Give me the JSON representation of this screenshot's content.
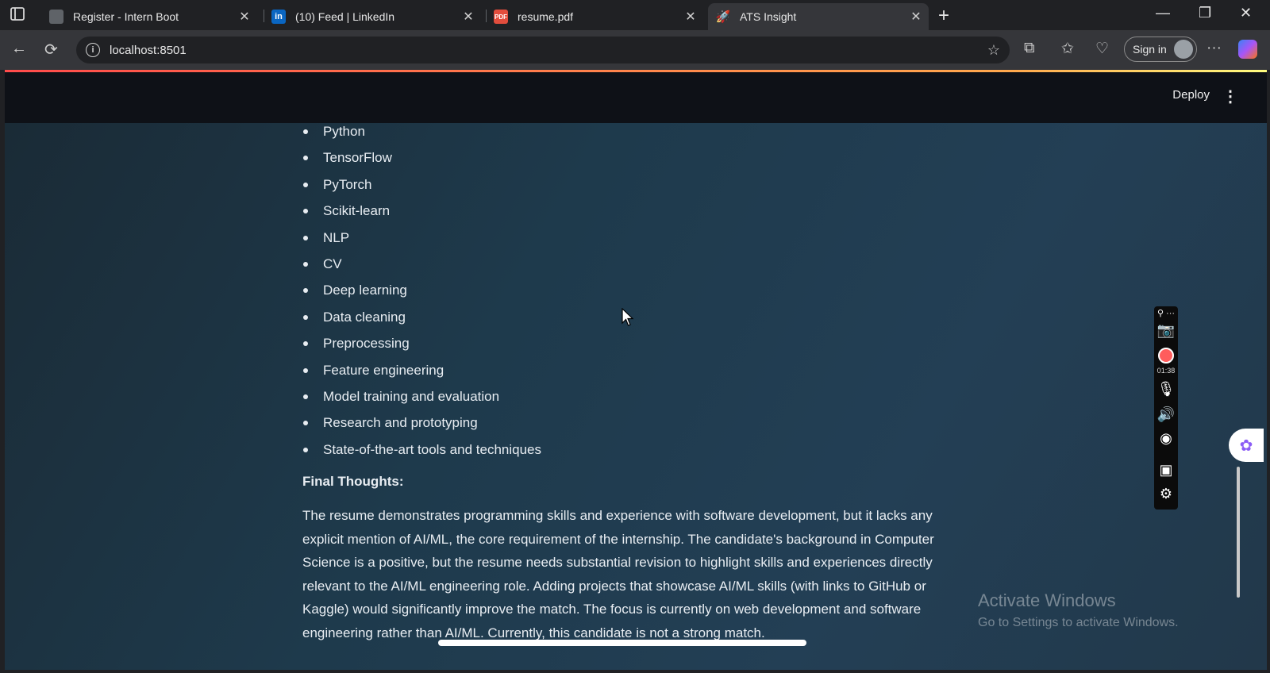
{
  "browser": {
    "tabs": [
      {
        "title": "Register - Intern Boot",
        "favicon": "page-icon"
      },
      {
        "title": "(10) Feed | LinkedIn",
        "favicon": "linkedin-icon"
      },
      {
        "title": "resume.pdf",
        "favicon": "pdf-icon"
      },
      {
        "title": "ATS Insight",
        "favicon": "rocket-icon",
        "active": true
      }
    ],
    "url": "localhost:8501",
    "signin_label": "Sign in"
  },
  "app": {
    "deploy_label": "Deploy",
    "skills": [
      "Python",
      "TensorFlow",
      "PyTorch",
      "Scikit-learn",
      "NLP",
      "CV",
      "Deep learning",
      "Data cleaning",
      "Preprocessing",
      "Feature engineering",
      "Model training and evaluation",
      "Research and prototyping",
      "State-of-the-art tools and techniques"
    ],
    "final_heading": "Final Thoughts:",
    "final_text": "The resume demonstrates programming skills and experience with software development, but it lacks any explicit mention of AI/ML, the core requirement of the internship. The candidate's background in Computer Science is a positive, but the resume needs substantial revision to highlight skills and experiences directly relevant to the AI/ML engineering role. Adding projects that showcase AI/ML skills (with links to GitHub or Kaggle) would significantly improve the match. The focus is currently on web development and software engineering rather than AI/ML. Currently, this candidate is not a strong match."
  },
  "recorder": {
    "time": "01:38"
  },
  "watermark": {
    "line1": "Activate Windows",
    "line2": "Go to Settings to activate Windows."
  }
}
